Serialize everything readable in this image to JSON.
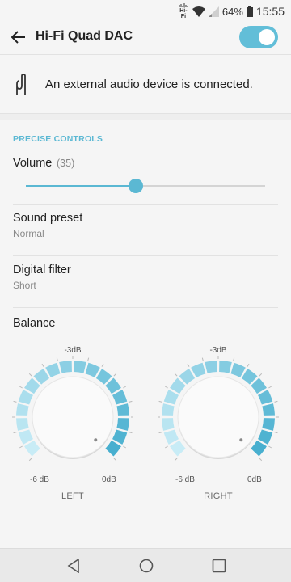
{
  "status": {
    "hifi_label": "Hi-Fi",
    "battery": "64%",
    "time": "15:55"
  },
  "header": {
    "title": "Hi-Fi Quad DAC",
    "toggle_on": true
  },
  "notice": {
    "text": "An external audio device is connected."
  },
  "section": {
    "title": "PRECISE CONTROLS"
  },
  "volume": {
    "label": "Volume",
    "value_text": "(35)",
    "fraction": 0.46
  },
  "sound_preset": {
    "title": "Sound preset",
    "value": "Normal"
  },
  "digital_filter": {
    "title": "Digital filter",
    "value": "Short"
  },
  "balance": {
    "label": "Balance",
    "left": {
      "name": "LEFT",
      "top_label": "-3dB",
      "min_label": "-6 dB",
      "max_label": "0dB",
      "level": 1.0
    },
    "right": {
      "name": "RIGHT",
      "top_label": "-3dB",
      "min_label": "-6 dB",
      "max_label": "0dB",
      "level": 1.0
    }
  },
  "colors": {
    "accent": "#5bb8d3",
    "toggle": "#62bed8",
    "segment_light": "#c8ecf6",
    "segment_dark": "#48afcf"
  },
  "nav": {
    "back_icon": "triangle-back-icon",
    "home_icon": "circle-home-icon",
    "recents_icon": "square-recents-icon"
  }
}
